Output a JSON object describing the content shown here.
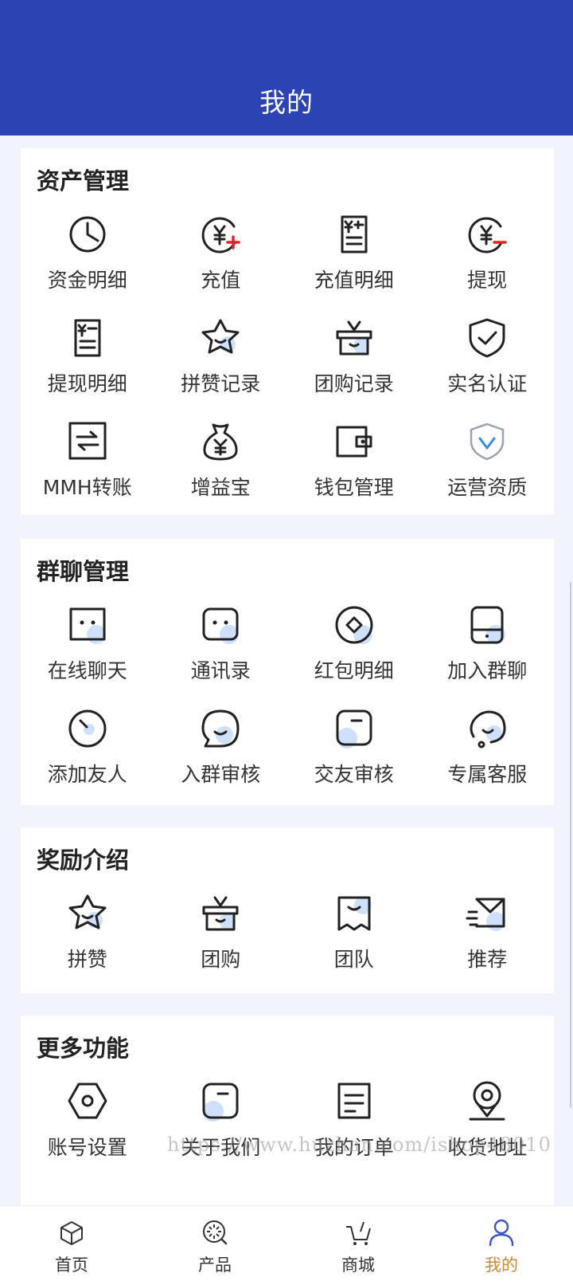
{
  "header": {
    "title": "我的"
  },
  "sections": [
    {
      "title": "资产管理",
      "items": [
        {
          "label": "资金明细",
          "icon": "pie-chart-icon"
        },
        {
          "label": "充值",
          "icon": "yuan-plus-icon"
        },
        {
          "label": "充值明细",
          "icon": "recharge-receipt-icon"
        },
        {
          "label": "提现",
          "icon": "yuan-minus-icon"
        },
        {
          "label": "提现明细",
          "icon": "withdraw-receipt-icon"
        },
        {
          "label": "拼赞记录",
          "icon": "star-icon"
        },
        {
          "label": "团购记录",
          "icon": "gift-box-icon"
        },
        {
          "label": "实名认证",
          "icon": "shield-check-icon"
        },
        {
          "label": "MMH转账",
          "icon": "transfer-icon"
        },
        {
          "label": "增益宝",
          "icon": "money-bag-icon"
        },
        {
          "label": "钱包管理",
          "icon": "wallet-icon"
        },
        {
          "label": "运营资质",
          "icon": "shield-v-icon"
        }
      ]
    },
    {
      "title": "群聊管理",
      "items": [
        {
          "label": "在线聊天",
          "icon": "chat-face-icon"
        },
        {
          "label": "通讯录",
          "icon": "contacts-face-icon"
        },
        {
          "label": "红包明细",
          "icon": "red-packet-icon"
        },
        {
          "label": "加入群聊",
          "icon": "join-group-icon"
        },
        {
          "label": "添加友人",
          "icon": "add-friend-icon"
        },
        {
          "label": "入群审核",
          "icon": "speech-bubble-icon"
        },
        {
          "label": "交友审核",
          "icon": "card-dash-icon"
        },
        {
          "label": "专属客服",
          "icon": "customer-service-icon"
        }
      ]
    },
    {
      "title": "奖励介绍",
      "items": [
        {
          "label": "拼赞",
          "icon": "star-icon"
        },
        {
          "label": "团购",
          "icon": "gift-box-icon"
        },
        {
          "label": "团队",
          "icon": "team-icon"
        },
        {
          "label": "推荐",
          "icon": "mail-send-icon"
        }
      ]
    },
    {
      "title": "更多功能",
      "items": [
        {
          "label": "账号设置",
          "icon": "hexagon-settings-icon"
        },
        {
          "label": "关于我们",
          "icon": "card-dash-icon"
        },
        {
          "label": "我的订单",
          "icon": "order-list-icon"
        },
        {
          "label": "收货地址",
          "icon": "location-pin-icon"
        }
      ]
    }
  ],
  "watermark": "https://www.huzhan.com/ishop48010",
  "tabbar": [
    {
      "label": "首页",
      "icon": "home-box-icon",
      "active": false
    },
    {
      "label": "产品",
      "icon": "product-icon",
      "active": false
    },
    {
      "label": "商城",
      "icon": "cart-icon",
      "active": false
    },
    {
      "label": "我的",
      "icon": "user-icon",
      "active": true
    }
  ],
  "colors": {
    "header_bg": "#2c43b4",
    "accent_light": "#cfe0fb",
    "icon_stroke": "#222222",
    "tab_active": "#c98a3e"
  }
}
